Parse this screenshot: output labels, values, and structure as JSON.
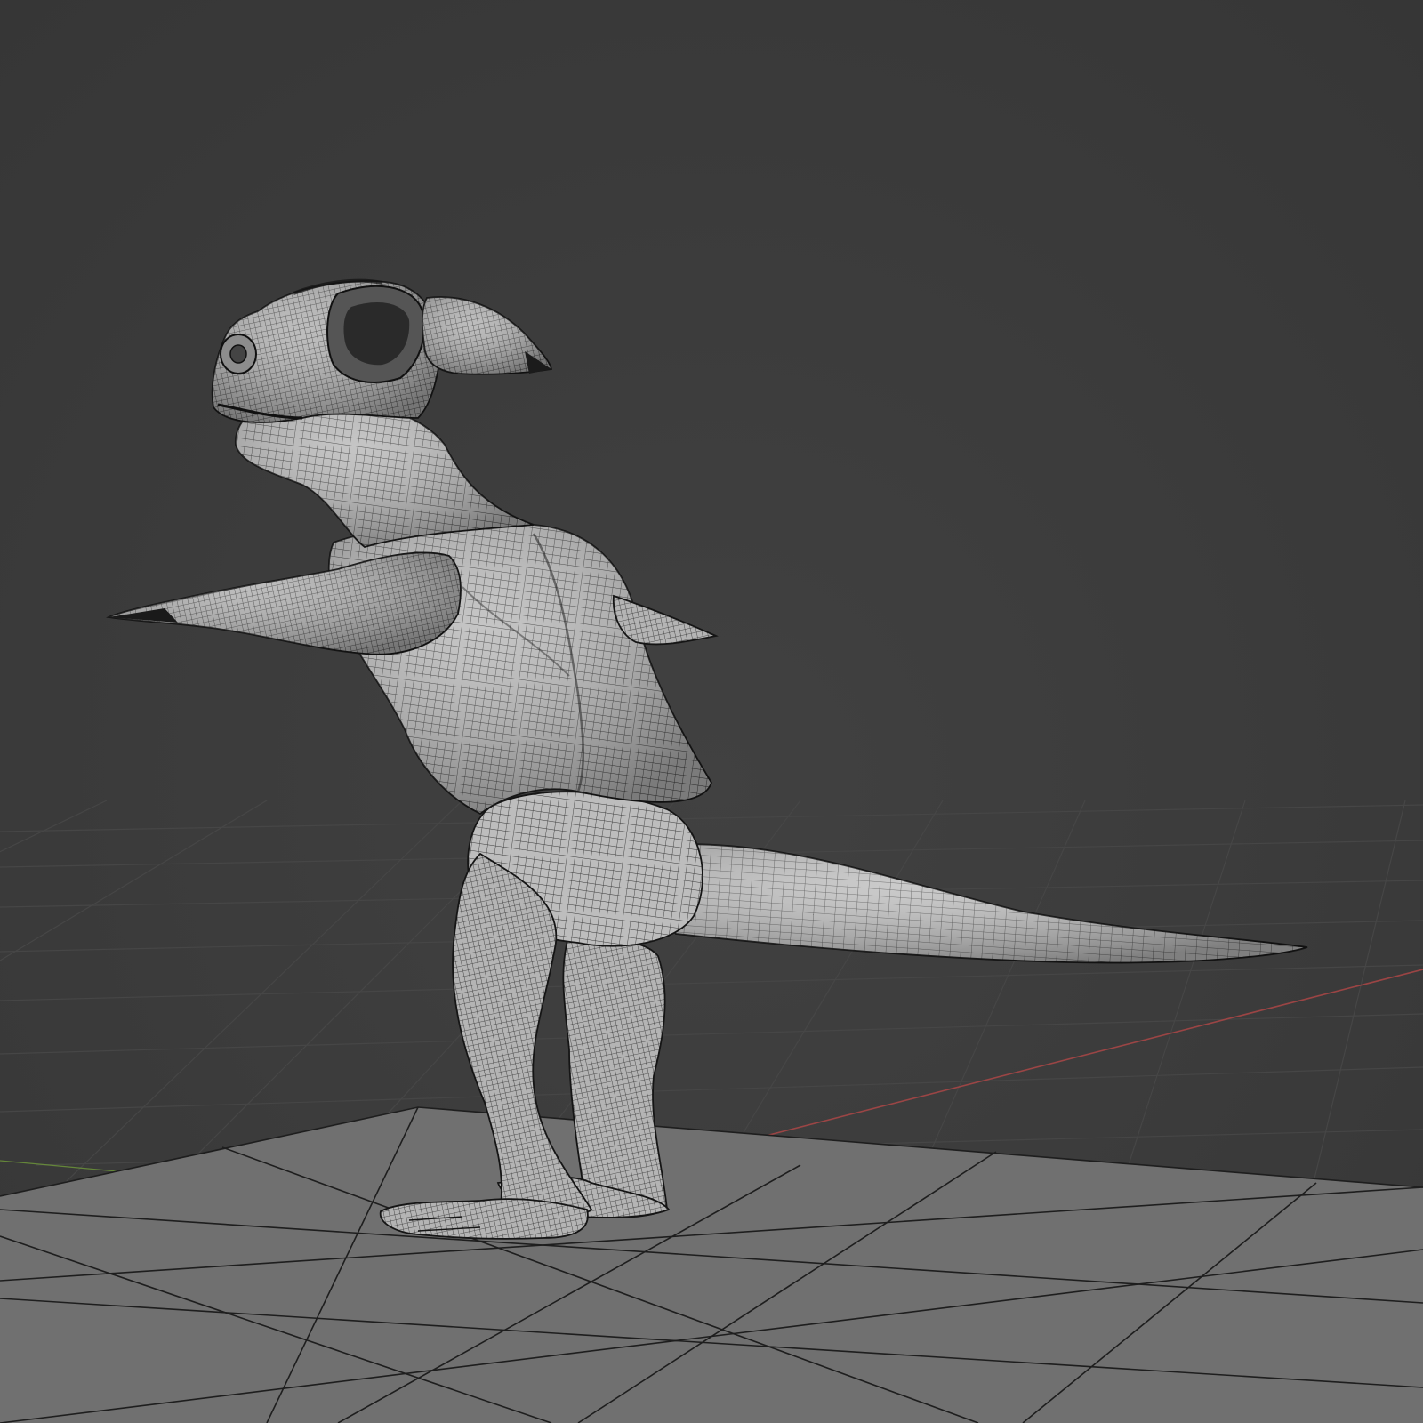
{
  "viewport": {
    "mode": "3d-viewport",
    "shading": "solid-with-wireframe-overlay",
    "background_color": "#3b3b3b",
    "grid_line_color": "#4a4a4a",
    "ground_plane_color": "#6e6e6e",
    "ground_plane_line_color": "#1f1f1f",
    "x_axis_color": "#b24a4a",
    "y_axis_color": "#6f9a3a",
    "mesh_surface_color": "#b9b9b9",
    "mesh_wire_color": "#1a1a1a"
  },
  "scene": {
    "object": "creature-sculpt",
    "parts": [
      "head",
      "horn-left",
      "horn-right",
      "neck",
      "torso",
      "arm-left",
      "arm-right",
      "pelvis",
      "tail",
      "leg-left",
      "leg-right",
      "foot-left",
      "foot-right"
    ]
  }
}
